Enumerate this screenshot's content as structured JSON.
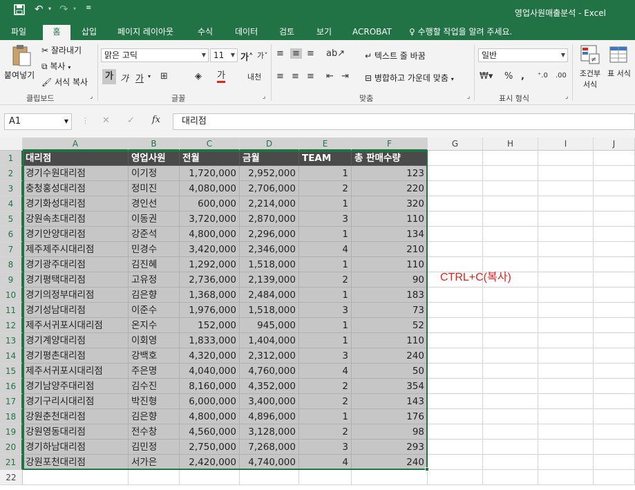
{
  "app": {
    "title": "영업사원매출분석 - Excel"
  },
  "quick_access": {
    "save_icon": "save-icon",
    "undo_icon": "undo-icon",
    "redo_icon": "redo-icon"
  },
  "tabs": [
    "파일",
    "홈",
    "삽입",
    "페이지 레이아웃",
    "수식",
    "데이터",
    "검토",
    "보기",
    "ACROBAT"
  ],
  "active_tab": "홈",
  "tell_me": "수행할 작업을 알려 주세요.",
  "ribbon": {
    "clipboard": {
      "paste": "붙여넣기",
      "cut": "잘라내기",
      "copy": "복사",
      "format_painter": "서식 복사",
      "label": "클립보드"
    },
    "font": {
      "name": "맑은 고딕",
      "size": "11",
      "label": "글꼴"
    },
    "alignment": {
      "wrap": "텍스트 줄 바꿈",
      "merge": "병합하고 가운데 맞춤",
      "label": "맞춤"
    },
    "number": {
      "format": "일반",
      "label": "표시 형식"
    },
    "styles": {
      "cond": "조건부 서식",
      "table": "표 서식"
    }
  },
  "formula_bar": {
    "cell_ref": "A1",
    "fx": "fx",
    "content": "대리점"
  },
  "columns": [
    "A",
    "B",
    "C",
    "D",
    "E",
    "F",
    "G",
    "H",
    "I",
    "J"
  ],
  "headers": [
    "대리점",
    "영업사원",
    "전월",
    "금월",
    "TEAM",
    "총 판매수량"
  ],
  "rows": [
    [
      "경기수원대리점",
      "이기정",
      "1,720,000",
      "2,952,000",
      "1",
      "123"
    ],
    [
      "충청홍성대리점",
      "정미진",
      "4,080,000",
      "2,706,000",
      "2",
      "220"
    ],
    [
      "경기화성대리점",
      "경인선",
      "600,000",
      "2,214,000",
      "1",
      "320"
    ],
    [
      "강원속초대리점",
      "이동권",
      "3,720,000",
      "2,870,000",
      "3",
      "110"
    ],
    [
      "경기안양대리점",
      "강준석",
      "4,800,000",
      "2,296,000",
      "1",
      "134"
    ],
    [
      "제주제주시대리점",
      "민경수",
      "3,420,000",
      "2,346,000",
      "4",
      "210"
    ],
    [
      "경기광주대리점",
      "김진혜",
      "1,292,000",
      "1,518,000",
      "1",
      "110"
    ],
    [
      "경기평택대리점",
      "고유정",
      "2,736,000",
      "2,139,000",
      "2",
      "90"
    ],
    [
      "경기의정부대리점",
      "김은향",
      "1,368,000",
      "2,484,000",
      "1",
      "183"
    ],
    [
      "경기성남대리점",
      "이준수",
      "1,976,000",
      "1,518,000",
      "3",
      "73"
    ],
    [
      "제주서귀포시대리점",
      "온지수",
      "152,000",
      "945,000",
      "1",
      "52"
    ],
    [
      "경기계양대리점",
      "이회영",
      "1,833,000",
      "1,404,000",
      "1",
      "110"
    ],
    [
      "경기평촌대리점",
      "강백호",
      "4,320,000",
      "2,312,000",
      "3",
      "240"
    ],
    [
      "제주서귀포시대리점",
      "주은명",
      "4,040,000",
      "4,760,000",
      "4",
      "50"
    ],
    [
      "경기남양주대리점",
      "김수진",
      "8,160,000",
      "4,352,000",
      "2",
      "354"
    ],
    [
      "경기구리시대리점",
      "박진형",
      "6,000,000",
      "3,400,000",
      "2",
      "143"
    ],
    [
      "강원춘천대리점",
      "김은향",
      "4,800,000",
      "4,896,000",
      "1",
      "176"
    ],
    [
      "강원영동대리점",
      "전수창",
      "4,560,000",
      "3,128,000",
      "2",
      "98"
    ],
    [
      "경기하남대리점",
      "김민정",
      "2,750,000",
      "7,268,000",
      "3",
      "293"
    ],
    [
      "강원포천대리점",
      "서가은",
      "2,420,000",
      "4,740,000",
      "4",
      "240"
    ]
  ],
  "note": "CTRL+C(복사)"
}
